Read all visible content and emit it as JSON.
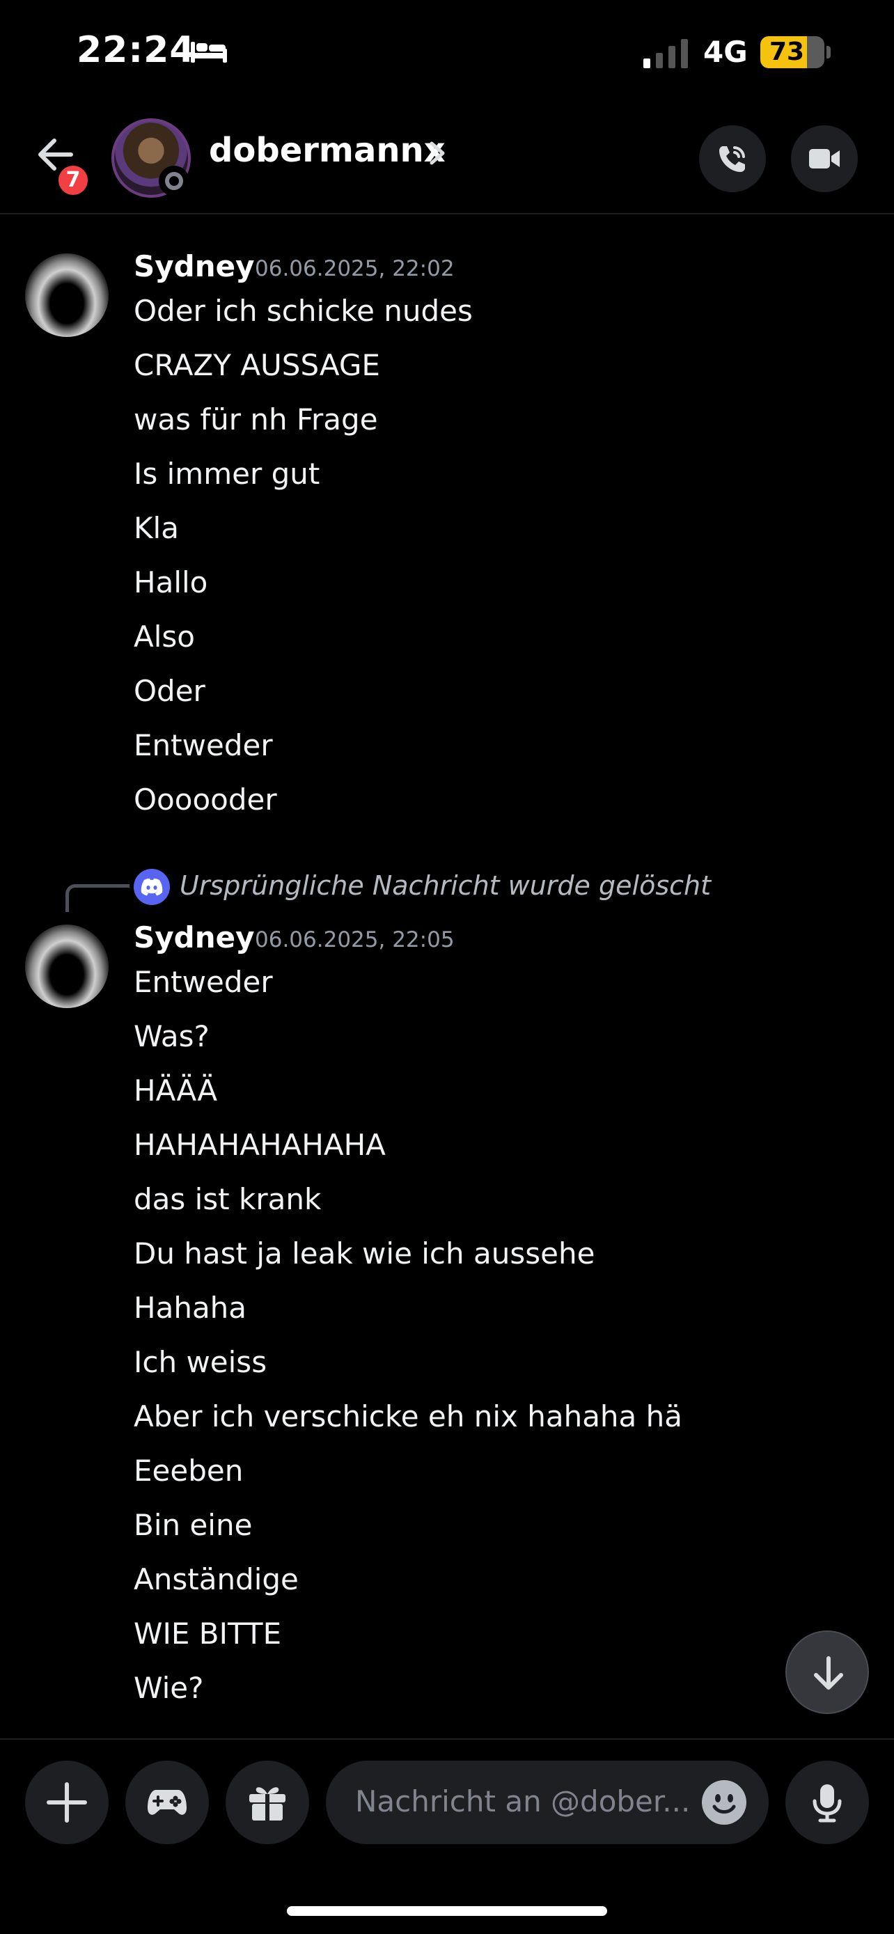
{
  "status_bar": {
    "time": "22:24",
    "network": "4G",
    "battery": "73",
    "battery_level": 0.73,
    "battery_color": "#f5c20e"
  },
  "header": {
    "unread_count": "7",
    "dm_name": "dobermannx"
  },
  "messages": [
    {
      "author": "Sydney",
      "timestamp": "06.06.2025, 22:02",
      "lines": [
        "Oder ich schicke nudes",
        "CRAZY AUSSAGE",
        "was für nh Frage",
        "Is immer gut",
        "Kla",
        "Hallo",
        "Also",
        "Oder",
        "Entweder",
        "Oooooder"
      ]
    },
    {
      "reply_note": "Ursprüngliche Nachricht wurde gelöscht",
      "author": "Sydney",
      "timestamp": "06.06.2025, 22:05",
      "lines": [
        "Entweder",
        "Was?",
        "HÄÄÄ",
        "HAHAHAHAHAHA",
        "das ist krank",
        "Du hast ja leak wie ich aussehe",
        "Hahaha",
        "Ich weiss",
        "Aber ich verschicke eh nix hahaha hä",
        "Eeeben",
        "Bin eine",
        "Anständige",
        "WIE BITTE",
        "Wie?"
      ]
    }
  ],
  "composer": {
    "placeholder": "Nachricht an @dober..."
  },
  "icons": {
    "back": "arrow-left-icon",
    "call": "phone-icon",
    "video": "video-camera-icon",
    "attach": "plus-icon",
    "games": "gamepad-icon",
    "gift": "gift-icon",
    "emoji": "smiley-icon",
    "voice": "microphone-icon",
    "scroll": "arrow-down-icon",
    "sleep": "bed-icon",
    "discord": "discord-logo-icon"
  },
  "colors": {
    "accent": "#5865f2",
    "badge": "#f23f43",
    "background": "#000000"
  }
}
